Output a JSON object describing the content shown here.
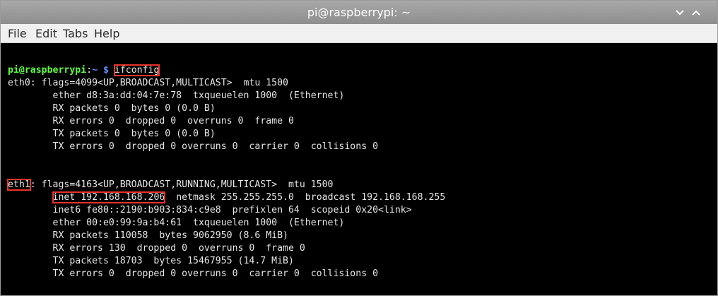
{
  "window": {
    "title": "pi@raspberrypi: ~",
    "colors": {
      "titlebar": "#9a9a9a",
      "highlight_box": "#e8322c",
      "prompt_user": "#5fff3f",
      "prompt_path": "#5b8dff"
    }
  },
  "menu": {
    "items": [
      "File",
      "Edit",
      "Tabs",
      "Help"
    ]
  },
  "terminal": {
    "prompt_user": "pi@raspberrypi",
    "prompt_sep": ":",
    "prompt_path": "~ $",
    "command": "ifconfig",
    "eth0": {
      "header": "eth0: flags=4099<UP,BROADCAST,MULTICAST>  mtu 1500",
      "lines": [
        "        ether d8:3a:dd:04:7e:78  txqueuelen 1000  (Ethernet)",
        "        RX packets 0  bytes 0 (0.0 B)",
        "        RX errors 0  dropped 0  overruns 0  frame 0",
        "        TX packets 0  bytes 0 (0.0 B)",
        "        TX errors 0  dropped 0 overruns 0  carrier 0  collisions 0"
      ]
    },
    "eth1": {
      "name": "eth1",
      "header_rest": ": flags=4163<UP,BROADCAST,RUNNING,MULTICAST>  mtu 1500",
      "indent": "        ",
      "inet": "inet 192.168.168.206",
      "inet_rest": "  netmask 255.255.255.0  broadcast 192.168.168.255",
      "lines": [
        "        inet6 fe80::2190:b903:834:c9e8  prefixlen 64  scopeid 0x20<link>",
        "        ether 00:e0:99:9a:b4:61  txqueuelen 1000  (Ethernet)",
        "        RX packets 110058  bytes 9062950 (8.6 MiB)",
        "        RX errors 130  dropped 0  overruns 0  frame 0",
        "        TX packets 18703  bytes 15467955 (14.7 MiB)",
        "        TX errors 0  dropped 0 overruns 0  carrier 0  collisions 0"
      ]
    }
  }
}
